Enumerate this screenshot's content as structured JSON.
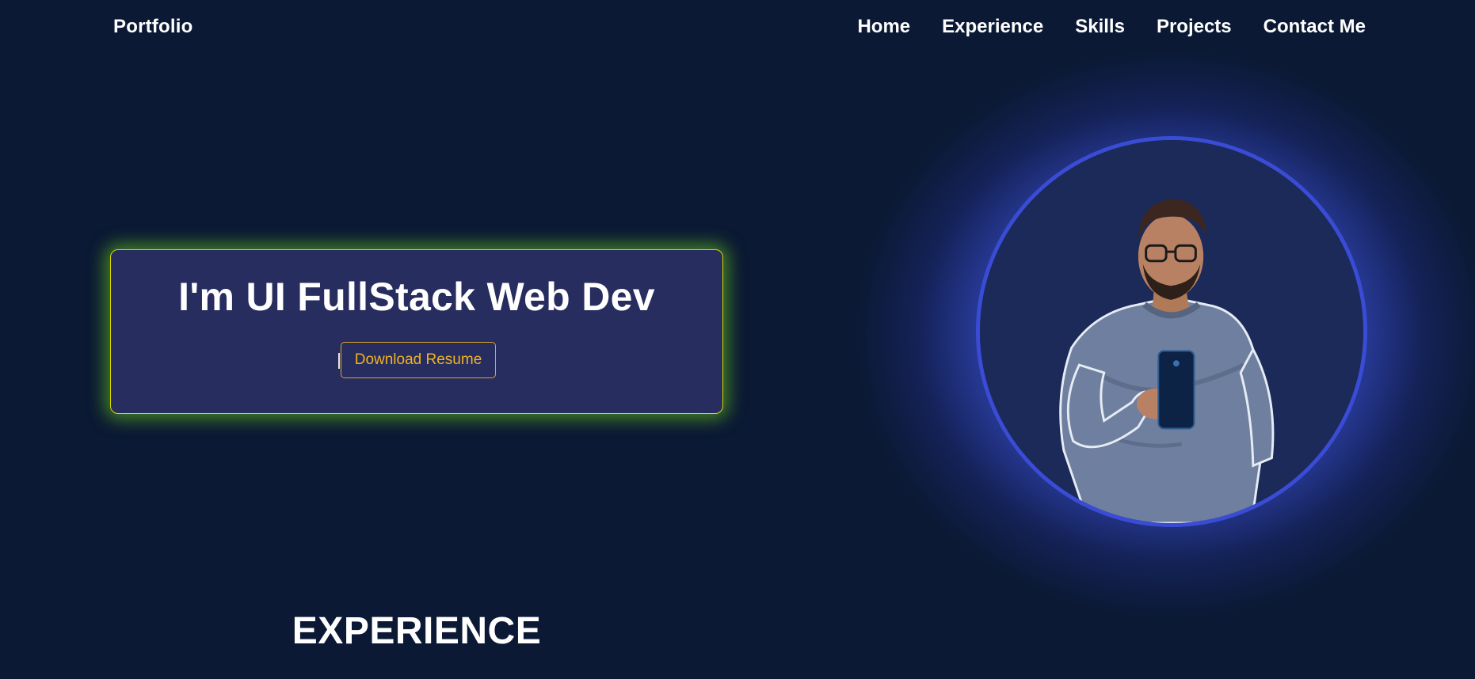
{
  "nav": {
    "brand": "Portfolio",
    "links": [
      "Home",
      "Experience",
      "Skills",
      "Projects",
      "Contact Me"
    ]
  },
  "hero": {
    "title": "I'm UI FullStack Web Dev",
    "download_label": "Download Resume"
  },
  "profile": {
    "image_description": "profile-photo"
  },
  "sections": {
    "experience_title": "EXPERIENCE"
  },
  "colors": {
    "background": "#0b1934",
    "card": "#272d5e",
    "card_border": "#d6d600",
    "card_glow": "#58aa1e",
    "button_accent": "#f0b323",
    "avatar_ring": "#3a4cd6",
    "avatar_glow": "#465ceb"
  }
}
